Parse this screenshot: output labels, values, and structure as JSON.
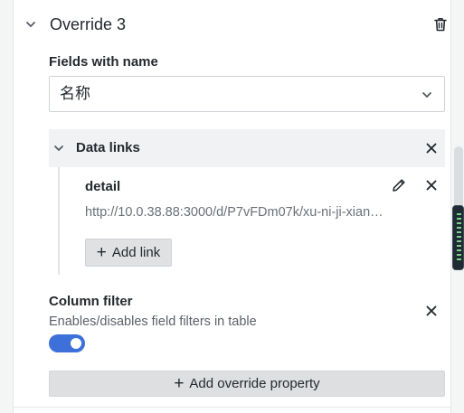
{
  "override": {
    "title": "Override 3",
    "collapse_icon": "chevron-down-icon",
    "delete_icon": "trash-icon"
  },
  "matcher": {
    "label": "Fields with name",
    "selected_value": "名称",
    "dropdown_icon": "chevron-down-icon"
  },
  "data_links": {
    "title": "Data links",
    "links": [
      {
        "title": "detail",
        "url": "http://10.0.38.88:3000/d/P7vFDm07k/xu-ni-ji-xian…",
        "edit_icon": "pencil-icon",
        "remove_icon": "close-icon"
      }
    ],
    "add_link_label": "Add link",
    "add_icon": "plus-icon",
    "remove_icon": "close-icon"
  },
  "column_filter": {
    "label": "Column filter",
    "description": "Enables/disables field filters in table",
    "enabled": true,
    "remove_icon": "close-icon"
  },
  "add_override_property_label": "Add override property",
  "colors": {
    "toggle_on": "#3d71d9",
    "button_bg": "#dfe1e3",
    "header_bg": "#f1f2f3"
  }
}
